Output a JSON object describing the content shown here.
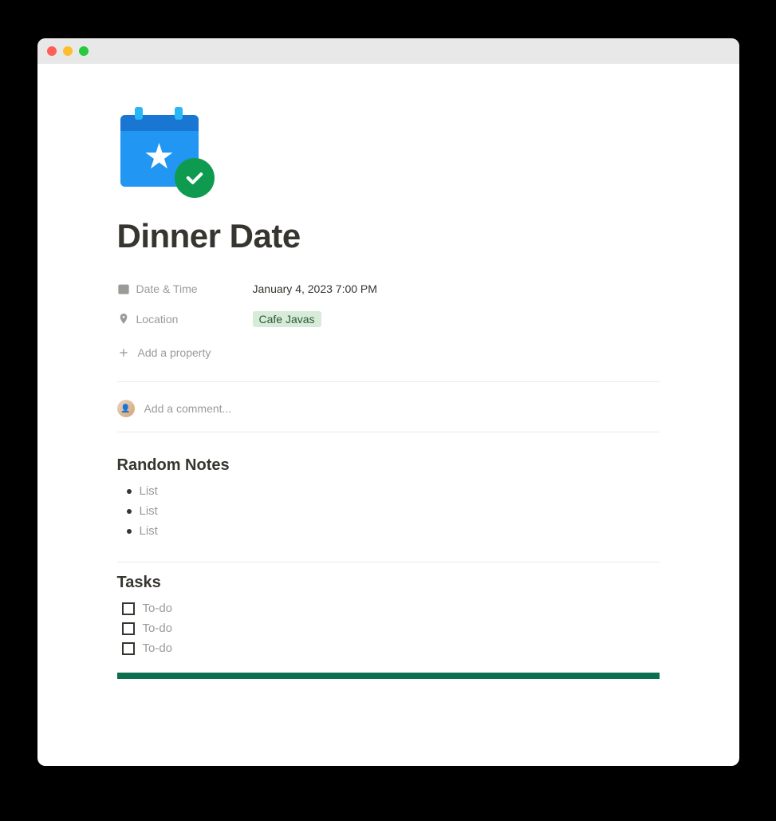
{
  "page": {
    "title": "Dinner Date"
  },
  "properties": {
    "date_time": {
      "label": "Date & Time",
      "value": "January 4, 2023 7:00 PM"
    },
    "location": {
      "label": "Location",
      "value": "Cafe Javas"
    },
    "add_property_label": "Add a property"
  },
  "comment": {
    "placeholder": "Add a comment..."
  },
  "sections": {
    "notes": {
      "heading": "Random Notes",
      "items": [
        "List",
        "List",
        "List"
      ]
    },
    "tasks": {
      "heading": "Tasks",
      "items": [
        "To-do",
        "To-do",
        "To-do"
      ]
    }
  }
}
